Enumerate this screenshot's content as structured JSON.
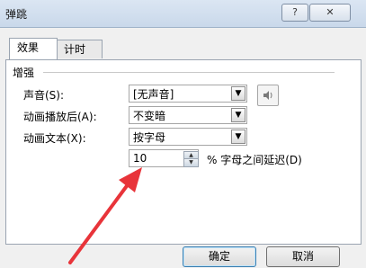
{
  "window": {
    "title": "弹跳",
    "help_icon": "?",
    "close_icon": "✕"
  },
  "tabs": [
    {
      "label": "效果",
      "active": true
    },
    {
      "label": "计时",
      "active": false
    }
  ],
  "enhance": {
    "group_label": "增强",
    "sound_label": "声音(S):",
    "sound_value": "[无声音]",
    "after_anim_label": "动画播放后(A):",
    "after_anim_value": "不变暗",
    "anim_text_label": "动画文本(X):",
    "anim_text_value": "按字母",
    "delay_value": "10",
    "delay_suffix": "% 字母之间延迟(D)"
  },
  "buttons": {
    "ok": "确定",
    "cancel": "取消"
  },
  "annotation": {
    "arrow_color": "#e8343a"
  }
}
